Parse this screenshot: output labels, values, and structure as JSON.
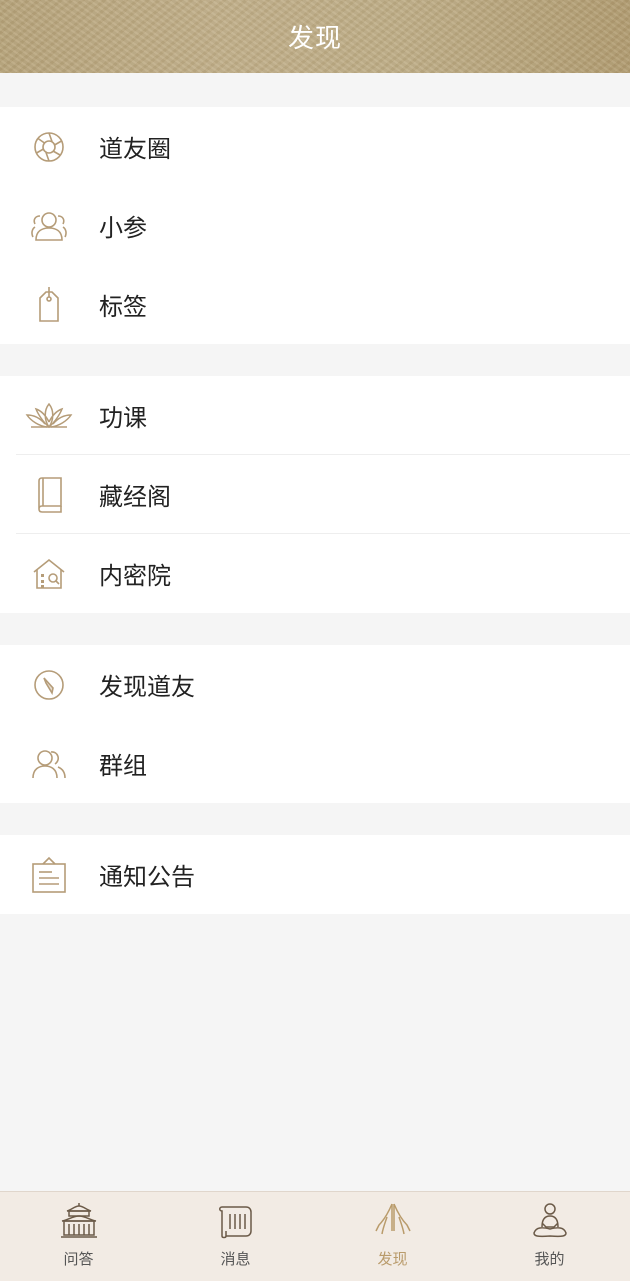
{
  "header": {
    "title": "发现"
  },
  "sections": [
    {
      "items": [
        {
          "label": "道友圈",
          "icon": "aperture-icon"
        },
        {
          "label": "小参",
          "icon": "people-icon"
        },
        {
          "label": "标签",
          "icon": "tag-icon"
        }
      ]
    },
    {
      "items": [
        {
          "label": "功课",
          "icon": "lotus-icon"
        },
        {
          "label": "藏经阁",
          "icon": "book-icon"
        },
        {
          "label": "内密院",
          "icon": "house-search-icon"
        }
      ]
    },
    {
      "items": [
        {
          "label": "发现道友",
          "icon": "compass-icon"
        },
        {
          "label": "群组",
          "icon": "group-icon"
        }
      ]
    },
    {
      "items": [
        {
          "label": "通知公告",
          "icon": "notice-board-icon"
        }
      ]
    }
  ],
  "tabbar": {
    "tabs": [
      {
        "label": "问答",
        "icon": "temple-icon",
        "active": false
      },
      {
        "label": "消息",
        "icon": "scroll-icon",
        "active": false
      },
      {
        "label": "发现",
        "icon": "praying-hands-icon",
        "active": true
      },
      {
        "label": "我的",
        "icon": "meditation-icon",
        "active": false
      }
    ]
  },
  "colors": {
    "icon": "#b59c78",
    "active_tab": "#b99b6b",
    "header_bg": "#bcaa82",
    "page_bg": "#f5f5f5"
  }
}
